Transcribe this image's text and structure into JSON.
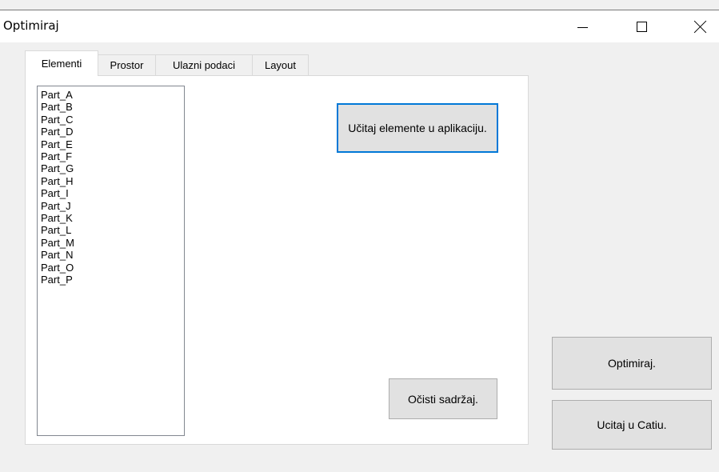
{
  "window": {
    "title": "Optimiraj"
  },
  "tabs": [
    {
      "label": "Elementi",
      "active": true
    },
    {
      "label": "Prostor",
      "active": false
    },
    {
      "label": "Ulazni podaci",
      "active": false
    },
    {
      "label": "Layout",
      "active": false
    }
  ],
  "listbox": {
    "items": [
      "Part_A",
      "Part_B",
      "Part_C",
      "Part_D",
      "Part_E",
      "Part_F",
      "Part_G",
      "Part_H",
      "Part_I",
      "Part_J",
      "Part_K",
      "Part_L",
      "Part_M",
      "Part_N",
      "Part_O",
      "Part_P"
    ]
  },
  "buttons": {
    "load_elements": "Učitaj elemente u aplikaciju.",
    "clear_content": "Očisti sadržaj.",
    "optimize": "Optimiraj.",
    "load_catia": "Ucitaj u Catiu."
  },
  "colors": {
    "focus_border": "#0078d7",
    "button_face": "#e1e1e1",
    "window_background": "#f0f0f0"
  }
}
